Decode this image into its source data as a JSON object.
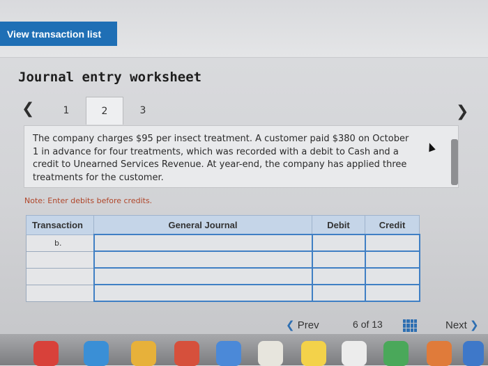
{
  "header": {
    "view_transaction_list": "View transaction list"
  },
  "worksheet": {
    "title": "Journal entry worksheet",
    "tabs": [
      "1",
      "2",
      "3"
    ],
    "active_tab": "2",
    "question_text": "The company charges $95 per insect treatment. A customer paid $380 on October 1 in advance for four treatments, which was recorded with a debit to Cash and a credit to Unearned Services Revenue. At year-end, the company has applied three treatments for the customer.",
    "note": "Note: Enter debits before credits."
  },
  "table": {
    "headers": {
      "transaction": "Transaction",
      "general_journal": "General Journal",
      "debit": "Debit",
      "credit": "Credit"
    },
    "rows": [
      {
        "transaction": "b.",
        "general_journal": "",
        "debit": "",
        "credit": ""
      },
      {
        "transaction": "",
        "general_journal": "",
        "debit": "",
        "credit": ""
      },
      {
        "transaction": "",
        "general_journal": "",
        "debit": "",
        "credit": ""
      },
      {
        "transaction": "",
        "general_journal": "",
        "debit": "",
        "credit": ""
      }
    ]
  },
  "pagination": {
    "prev_label": "Prev",
    "current": "6",
    "of": "of",
    "total": "13",
    "next_label": "Next"
  },
  "icons": {
    "prev_tab": "chevron-left-icon",
    "next_tab": "chevron-right-icon",
    "grid": "grid-icon"
  },
  "colors": {
    "accent": "#1f6fb5",
    "header_blue": "#c5d5e8",
    "note": "#b0462a"
  }
}
